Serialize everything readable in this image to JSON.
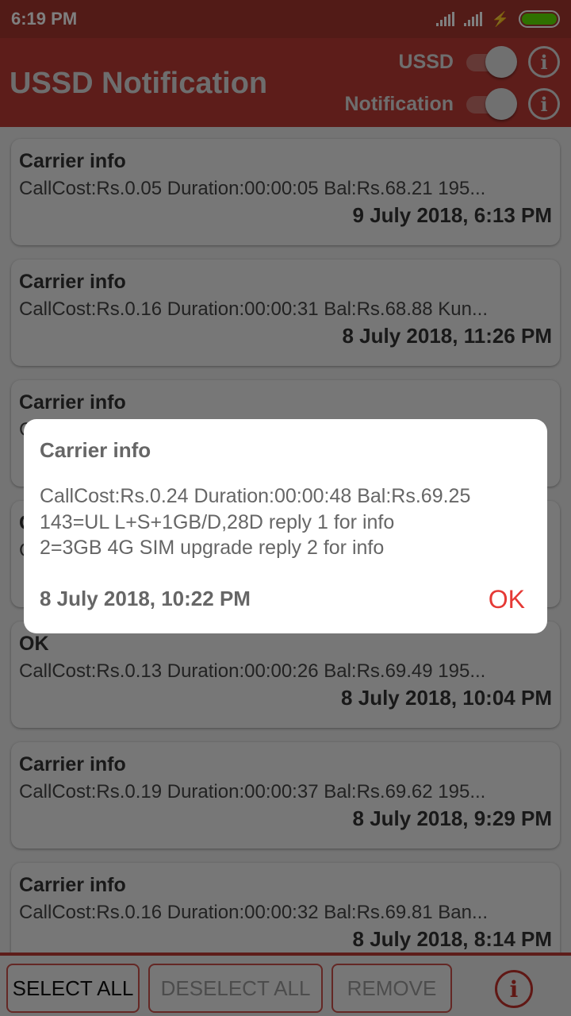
{
  "status_bar": {
    "time": "6:19 PM",
    "battery_color": "#5fe000"
  },
  "app_bar": {
    "title": "USSD Notification",
    "toggles": [
      {
        "label": "USSD",
        "on": true
      },
      {
        "label": "Notification",
        "on": true
      }
    ]
  },
  "messages": [
    {
      "title": "Carrier info",
      "body": "CallCost:Rs.0.05 Duration:00:00:05 Bal:Rs.68.21 195...",
      "date": "9 July 2018, 6:13 PM"
    },
    {
      "title": "Carrier info",
      "body": "CallCost:Rs.0.16 Duration:00:00:31 Bal:Rs.68.88 Kun...",
      "date": "8 July 2018, 11:26 PM"
    },
    {
      "title": "Carrier info",
      "body": "C",
      "date": ""
    },
    {
      "title": "C",
      "body": "C",
      "date": ""
    },
    {
      "title": "OK",
      "body": "CallCost:Rs.0.13 Duration:00:00:26 Bal:Rs.69.49 195...",
      "date": "8 July 2018, 10:04 PM"
    },
    {
      "title": "Carrier info",
      "body": "CallCost:Rs.0.19 Duration:00:00:37 Bal:Rs.69.62 195...",
      "date": "8 July 2018, 9:29 PM"
    },
    {
      "title": "Carrier info",
      "body": "CallCost:Rs.0.16 Duration:00:00:32 Bal:Rs.69.81 Ban...",
      "date": "8 July 2018, 8:14 PM"
    }
  ],
  "bottom_bar": {
    "select_all": "SELECT ALL",
    "deselect_all": "DESELECT ALL",
    "remove": "REMOVE"
  },
  "dialog": {
    "title": "Carrier info",
    "body": "CallCost:Rs.0.24 Duration:00:00:48 Bal:Rs.69.25\n143=UL L+S+1GB/D,28D reply 1 for info\n2=3GB 4G SIM upgrade reply 2 for info",
    "date": "8 July 2018, 10:22 PM",
    "ok": "OK",
    "ok_color": "#e53935"
  }
}
